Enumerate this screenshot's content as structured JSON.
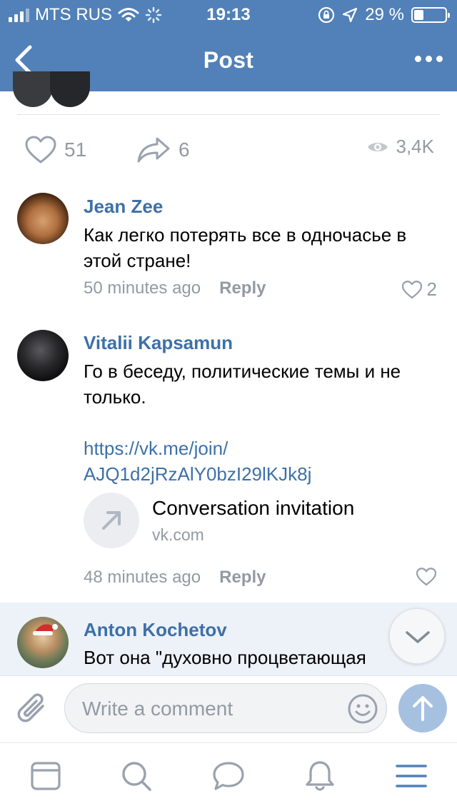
{
  "status_bar": {
    "carrier": "MTS RUS",
    "time": "19:13",
    "battery": "29 %",
    "battery_level": 0.29
  },
  "nav": {
    "title": "Post",
    "back_icon": "chevron-left-icon",
    "more_icon": "more-dots-icon"
  },
  "post_stats": {
    "likes": "51",
    "shares": "6",
    "views": "3,4K"
  },
  "comments": [
    {
      "author": "Jean Zee",
      "text": "Как легко потерять все в одночасье в этой стране!",
      "time": "50 minutes ago",
      "reply_label": "Reply",
      "likes": "2"
    },
    {
      "author": "Vitalii Kapsamun",
      "text": "Го в беседу, политические темы и не только.",
      "link_line1": "https://vk.me/join/",
      "link_line2": "AJQ1d2jRzAlY0bzI29lKJk8j",
      "attachment": {
        "title": "Conversation invitation",
        "domain": "vk.com"
      },
      "time": "48 minutes ago",
      "reply_label": "Reply"
    },
    {
      "author": "Anton Kochetov",
      "text": "Вот она \"духовно процветающая"
    }
  ],
  "composer": {
    "placeholder": "Write a comment"
  },
  "colors": {
    "header": "#5181b8",
    "link": "#3e70a8",
    "secondary": "#939aa3",
    "highlight": "#edf2f8",
    "send_button": "#a6c1e0"
  },
  "tabbar": {
    "items": [
      "newsfeed-icon",
      "search-icon",
      "messages-icon",
      "notifications-icon",
      "menu-icon"
    ]
  }
}
